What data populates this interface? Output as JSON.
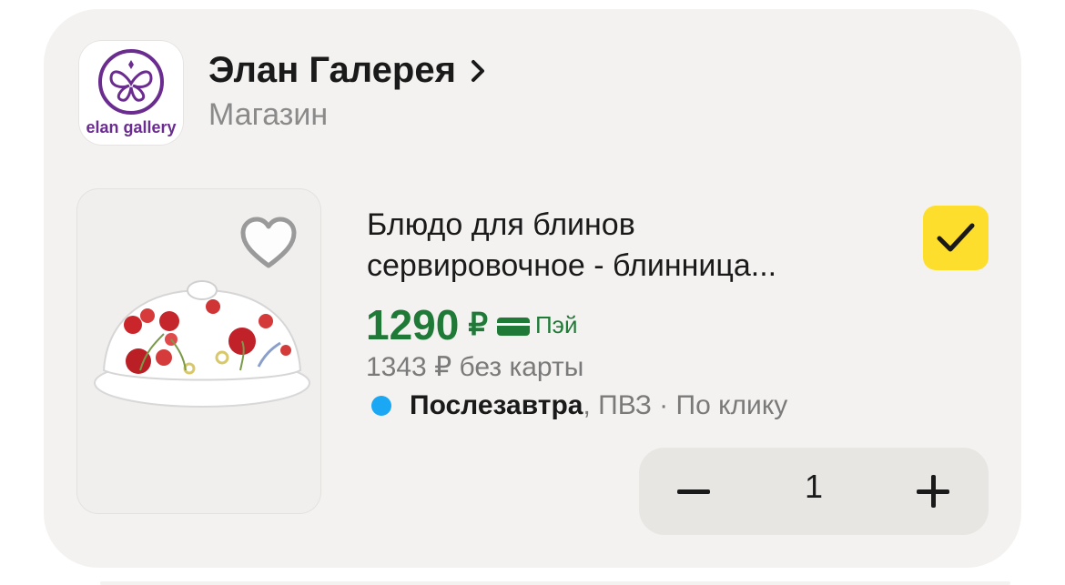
{
  "shop": {
    "logo_text": "elan gallery",
    "name": "Элан Галерея",
    "type": "Магазин"
  },
  "product": {
    "title_line1": "Блюдо для блинов",
    "title_line2": "сервировочное - блинница...",
    "selected": true,
    "favorite": false,
    "price": "1290",
    "currency": "₽",
    "pay_label": "Пэй",
    "old_price": "1343 ₽ без карты",
    "delivery_day": "Послезавтра",
    "delivery_rest": ", ПВЗ · По клику"
  },
  "quantity": {
    "value": "1"
  },
  "colors": {
    "accent_yellow": "#fdde2d",
    "price_green": "#1f7a37",
    "delivery_dot": "#1aa7f3",
    "brand_purple": "#6a2c8f"
  },
  "icons": [
    "butterfly-logo-icon",
    "chevron-right-icon",
    "heart-icon",
    "checkmark-icon",
    "card-icon",
    "minus-icon",
    "plus-icon"
  ]
}
